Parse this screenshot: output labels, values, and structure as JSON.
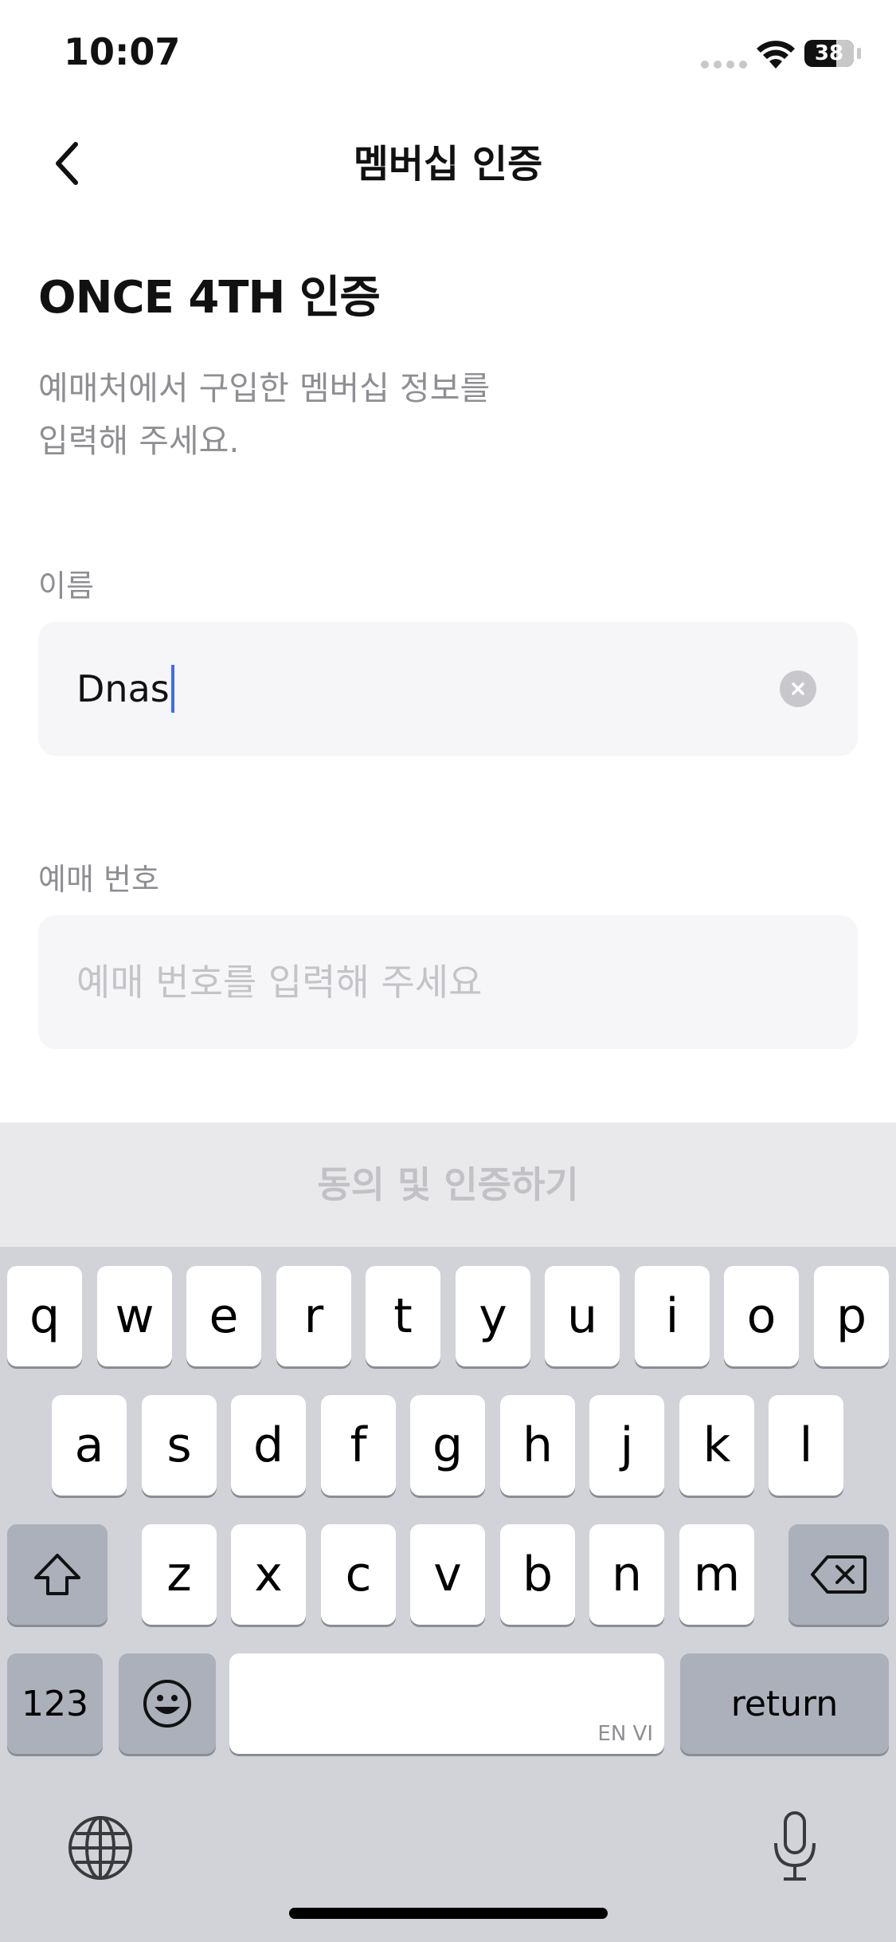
{
  "status_bar": {
    "time": "10:07",
    "battery": "38"
  },
  "nav": {
    "title": "멤버십 인증"
  },
  "page": {
    "heading": "ONCE 4TH 인증",
    "description_line1": "예매처에서 구입한 멤버십 정보를",
    "description_line2": "입력해 주세요."
  },
  "form": {
    "name": {
      "label": "이름",
      "value": "Dnas"
    },
    "ticket": {
      "label": "예매 번호",
      "placeholder": "예매 번호를 입력해 주세요"
    }
  },
  "cta": {
    "label": "동의 및 인증하기"
  },
  "keyboard": {
    "row1": [
      "q",
      "w",
      "e",
      "r",
      "t",
      "y",
      "u",
      "i",
      "o",
      "p"
    ],
    "row2": [
      "a",
      "s",
      "d",
      "f",
      "g",
      "h",
      "j",
      "k",
      "l"
    ],
    "row3": [
      "z",
      "x",
      "c",
      "v",
      "b",
      "n",
      "m"
    ],
    "numbers_label": "123",
    "return_label": "return",
    "space_hint": "EN VI"
  }
}
